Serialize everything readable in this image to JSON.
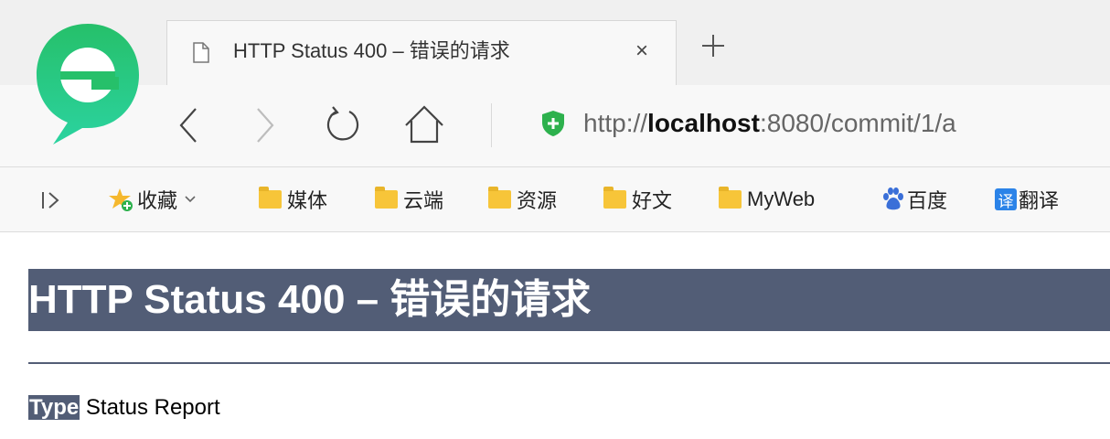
{
  "browser": {
    "tab": {
      "title": "HTTP Status 400 – 错误的请求",
      "close_label": "×"
    },
    "address_bar": {
      "prefix": "http://",
      "host": "localhost",
      "suffix": ":8080/commit/1/a"
    },
    "bookmarks": [
      {
        "label": "收藏",
        "icon": "star-icon"
      },
      {
        "label": "媒体",
        "icon": "folder-icon"
      },
      {
        "label": "云端",
        "icon": "folder-icon"
      },
      {
        "label": "资源",
        "icon": "folder-icon"
      },
      {
        "label": "好文",
        "icon": "folder-icon"
      },
      {
        "label": "MyWeb",
        "icon": "folder-icon"
      },
      {
        "label": "百度",
        "icon": "baidu-paw-icon"
      },
      {
        "label": "翻译",
        "icon": "translate-icon",
        "badge": "译"
      }
    ],
    "colors": {
      "chrome": "#f8f8f8",
      "tabstrip": "#f0f0f0",
      "secure_green": "#2db14d",
      "logo_green": "#1ec47a"
    }
  },
  "page": {
    "title": "HTTP Status 400 – 错误的请求",
    "type_label": "Type",
    "type_value": "Status Report",
    "colors": {
      "banner": "#525d76",
      "text": "#000000"
    }
  }
}
